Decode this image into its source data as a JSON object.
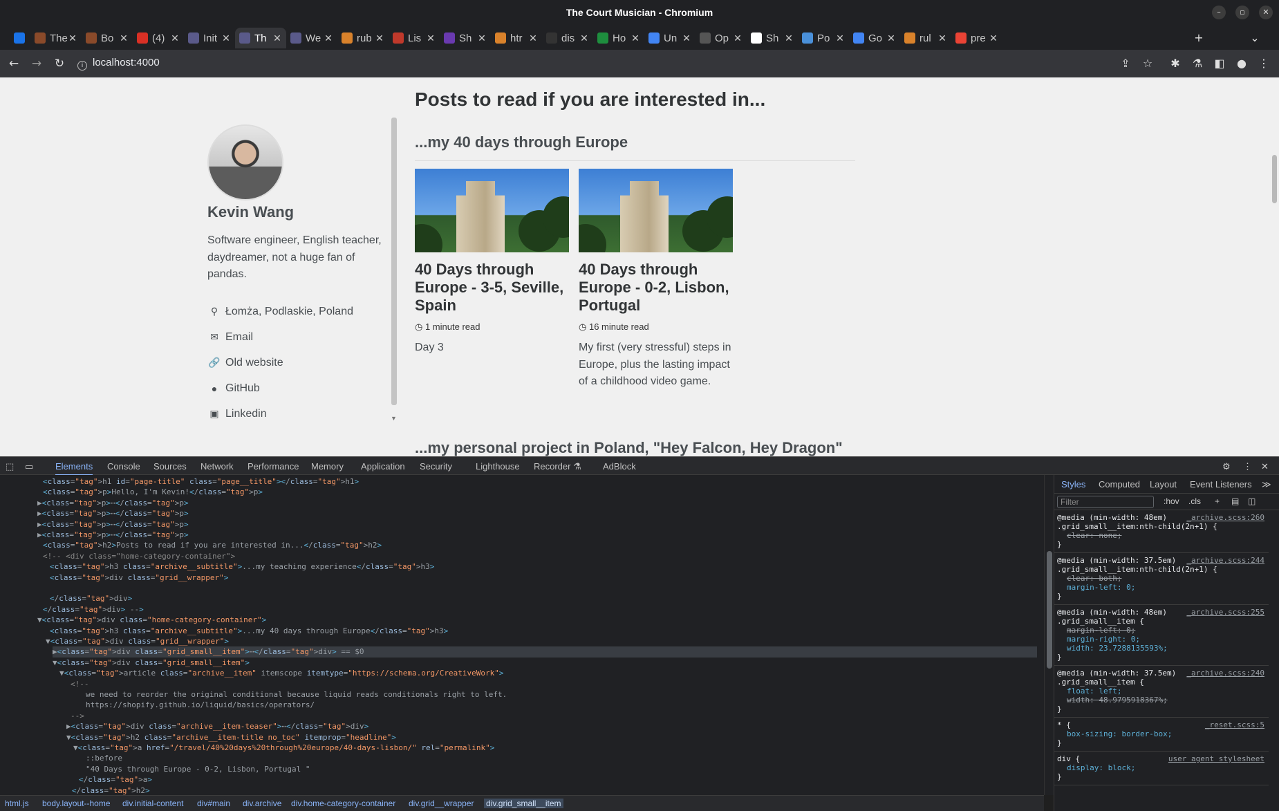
{
  "window": {
    "title": "The Court Musician - Chromium"
  },
  "tabs": [
    {
      "label": "",
      "color": "#1a73e8"
    },
    {
      "label": "The",
      "color": "#8a4a2a"
    },
    {
      "label": "Bo",
      "color": "#8a4a2a"
    },
    {
      "label": "(4)",
      "color": "#d93025"
    },
    {
      "label": "Init",
      "color": "#5a5a8a"
    },
    {
      "label": "Th",
      "color": "#5a5a8a"
    },
    {
      "label": "We",
      "color": "#5a5a8a"
    },
    {
      "label": "rub",
      "color": "#d9822b"
    },
    {
      "label": "Lis",
      "color": "#c0392b"
    },
    {
      "label": "Sh",
      "color": "#6a3ab0"
    },
    {
      "label": "htr",
      "color": "#d9822b"
    },
    {
      "label": "dis",
      "color": "#333333"
    },
    {
      "label": "Ho",
      "color": "#1e8e3e"
    },
    {
      "label": "Un",
      "color": "#4285f4"
    },
    {
      "label": "Op",
      "color": "#555555"
    },
    {
      "label": "Sh",
      "color": "#ffffff"
    },
    {
      "label": "Po",
      "color": "#4a90d9"
    },
    {
      "label": "Go",
      "color": "#4285f4"
    },
    {
      "label": "rul",
      "color": "#d9822b"
    },
    {
      "label": "pre",
      "color": "#ea4335"
    }
  ],
  "address": {
    "url": "localhost:4000"
  },
  "sidebar": {
    "name": "Kevin Wang",
    "bio": "Software engineer, English teacher, daydreamer, not a huge fan of pandas.",
    "links": [
      {
        "icon": "map-marker-icon",
        "glyph": "⚲",
        "label": "Łomża, Podlaskie, Poland"
      },
      {
        "icon": "envelope-icon",
        "glyph": "✉",
        "label": "Email"
      },
      {
        "icon": "link-icon",
        "glyph": "🔗",
        "label": "Old website"
      },
      {
        "icon": "github-icon",
        "glyph": "●",
        "label": "GitHub"
      },
      {
        "icon": "linkedin-icon",
        "glyph": "▣",
        "label": "Linkedin"
      }
    ]
  },
  "main": {
    "heading": "Posts to read if you are interested in...",
    "category1": "...my 40 days through Europe",
    "category2": "...my personal project in Poland, \"Hey Falcon, Hey Dragon\"",
    "posts": [
      {
        "title": "40 Days through Europe - 3-5, Seville, Spain",
        "read_time": "1 minute read",
        "excerpt": "Day 3"
      },
      {
        "title": "40 Days through Europe - 0-2, Lisbon, Portugal",
        "read_time": "16 minute read",
        "excerpt": "My first (very stressful) steps in Europe, plus the lasting impact of a childhood video game."
      }
    ]
  },
  "devtools": {
    "tabs": [
      "Elements",
      "Console",
      "Sources",
      "Network",
      "Performance",
      "Memory",
      "Application",
      "Security",
      "Lighthouse",
      "Recorder ⚗",
      "AdBlock"
    ],
    "styles_tabs": [
      "Styles",
      "Computed",
      "Layout",
      "Event Listeners"
    ],
    "filter_placeholder": "Filter",
    "hov": ":hov",
    "cls": ".cls",
    "breadcrumbs": [
      "html.js",
      "body.layout--home",
      "div.initial-content",
      "div#main",
      "div.archive",
      "div.home-category-container",
      "div.grid__wrapper",
      "div.grid_small__item"
    ],
    "dom_lines": [
      "<h1 id=\"page-title\" class=\"page__title\"></h1>",
      "<p>Hello, I'm Kevin!</p>",
      "▶<p>⋯</p>",
      "▶<p>⋯</p>",
      "▶<p>⋯</p>",
      "▶<p>⋯</p>",
      "<h2>Posts to read if you are interested in...</h2>",
      "<!-- <div class=\"home-category-container\">",
      "  <h3 class=\"archive__subtitle\">...my teaching experience</h3>",
      "  <div class=\"grid__wrapper\">",
      "",
      "  </div>",
      "</div> -->",
      "▼<div class=\"home-category-container\">",
      "  <h3 class=\"archive__subtitle\">...my 40 days through Europe</h3>",
      "  ▼<div class=\"grid__wrapper\">",
      "    ▶<div class=\"grid_small__item\">⋯</div> == $0",
      "    ▼<div class=\"grid_small__item\">",
      "      ▼<article class=\"archive__item\" itemscope itemtype=\"https://schema.org/CreativeWork\">",
      "          <!--",
      "            we need to reorder the original conditional because liquid reads conditionals right to left.",
      "            https://shopify.github.io/liquid/basics/operators/",
      "            -->",
      "        ▶<div class=\"archive__item-teaser\">⋯</div>",
      "        ▼<h2 class=\"archive__item-title no_toc\" itemprop=\"headline\">",
      "          ▼<a href=\"/travel/40%20days%20through%20europe/40-days-lisbon/\" rel=\"permalink\">",
      "              ::before",
      "              \"40 Days through Europe - 0-2, Lisbon, Portugal \"",
      "            </a>",
      "          </h2>"
    ],
    "style_rules": [
      {
        "selector": "@media (min-width: 48em)\n.grid_small__item:nth-child(2n+1) {",
        "src": "_archive.scss:260",
        "props": [
          {
            "p": "clear: none;",
            "strike": true
          }
        ]
      },
      {
        "selector": "@media (min-width: 37.5em)\n.grid_small__item:nth-child(2n+1) {",
        "src": "_archive.scss:244",
        "props": [
          {
            "p": "clear: both;",
            "strike": true
          },
          {
            "p": "margin-left: 0;",
            "strike": false
          }
        ]
      },
      {
        "selector": "@media (min-width: 48em)\n.grid_small__item {",
        "src": "_archive.scss:255",
        "props": [
          {
            "p": "margin-left: 0;",
            "strike": true
          },
          {
            "p": "margin-right: 0;",
            "strike": false
          },
          {
            "p": "width: 23.7288135593%;",
            "strike": false
          }
        ]
      },
      {
        "selector": "@media (min-width: 37.5em)\n.grid_small__item {",
        "src": "_archive.scss:240",
        "props": [
          {
            "p": "float: left;",
            "strike": false
          },
          {
            "p": "width: 48.9795918367%;",
            "strike": true
          }
        ]
      },
      {
        "selector": "* {",
        "src": "_reset.scss:5",
        "props": [
          {
            "p": "box-sizing: border-box;",
            "strike": false
          }
        ]
      },
      {
        "selector": "div {",
        "src": "user agent stylesheet",
        "props": [
          {
            "p": "display: block;",
            "strike": false
          }
        ]
      }
    ]
  }
}
